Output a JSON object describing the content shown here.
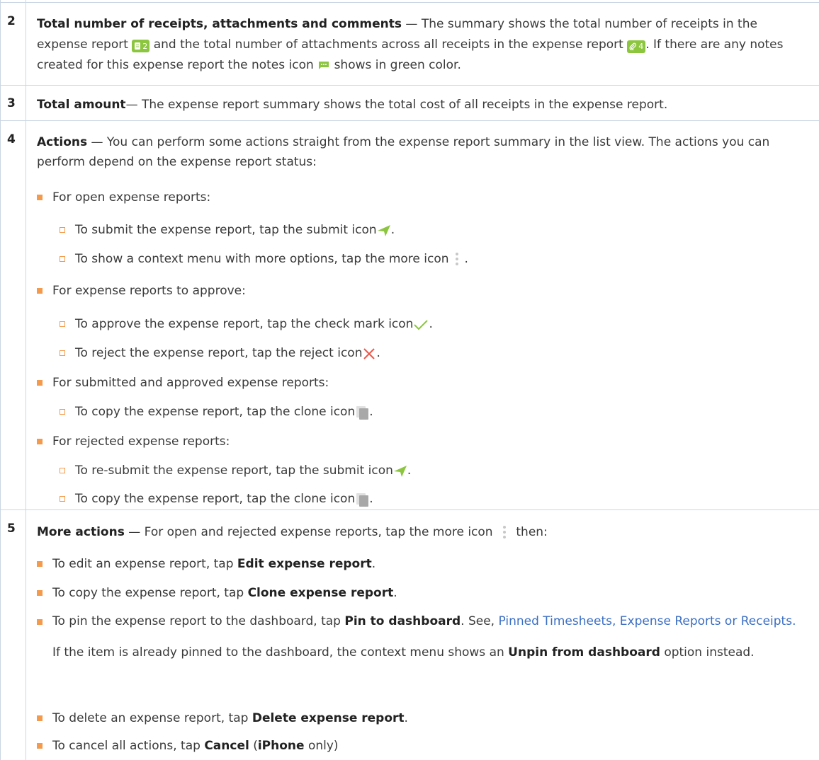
{
  "rows": {
    "r2": {
      "num": "2",
      "title": "Total number of receipts, attachments and comments",
      "t1": " — The summary shows the total number of receipts in the expense report ",
      "receipt_count": "2",
      "t2": " and the total number of attachments across all receipts in the expense report ",
      "attach_count": "4",
      "t3": ". If there are any notes created for this expense report the notes icon ",
      "t4": " shows in green color."
    },
    "r3": {
      "num": "3",
      "title": "Total amount",
      "t1": "— The expense report summary shows the total cost of all receipts in the expense report."
    },
    "r4": {
      "num": "4",
      "title": "Actions",
      "t1": " — You can perform some actions straight from the expense report summary in the list view. The actions you can perform depend on the expense report status:",
      "open": "For open expense reports:",
      "open_submit": "To submit the expense report, tap the submit icon ",
      "open_more": "To show a context menu with more options, tap the more icon ",
      "approve": "For expense reports to approve:",
      "approve_check": "To approve the expense report, tap the check mark icon ",
      "approve_reject": "To reject the expense report, tap the reject icon ",
      "submitted": "For submitted and approved expense reports:",
      "submitted_clone": "To copy the expense report, tap the clone icon ",
      "rejected": "For rejected expense reports:",
      "rejected_submit": "To re-submit the expense report, tap the submit icon ",
      "rejected_clone": "To copy the expense report, tap the clone icon "
    },
    "r5": {
      "num": "5",
      "title": "More actions",
      "t1": " — For open and rejected expense reports, tap the more icon ",
      "t1b": " then:",
      "edit_pre": "To edit an expense report, tap ",
      "edit_b": "Edit expense report",
      "clone_pre": "To copy the expense report, tap ",
      "clone_b": "Clone expense report",
      "pin_pre": "To pin the expense report to the dashboard, tap ",
      "pin_b": "Pin to dashboard",
      "pin_mid": ". See, ",
      "pin_link": "Pinned Timesheets, Expense Reports or Receipts.",
      "unpin_pre": "If the item is already pinned to the dashboard, the context menu shows an ",
      "unpin_b": "Unpin from dashboard",
      "unpin_post": " option instead.",
      "delete_pre": "To delete an expense report, tap ",
      "delete_b": "Delete expense report",
      "cancel_pre": "To cancel all actions, tap ",
      "cancel_b": "Cancel",
      "cancel_mid": " (",
      "cancel_b2": "iPhone",
      "cancel_post": " only)"
    }
  },
  "colors": {
    "accent": "#f39a4c",
    "icon_green": "#8cc63f",
    "reject_red": "#e8574a",
    "link": "#3b6fc4",
    "rule": "#c9d6e3"
  }
}
